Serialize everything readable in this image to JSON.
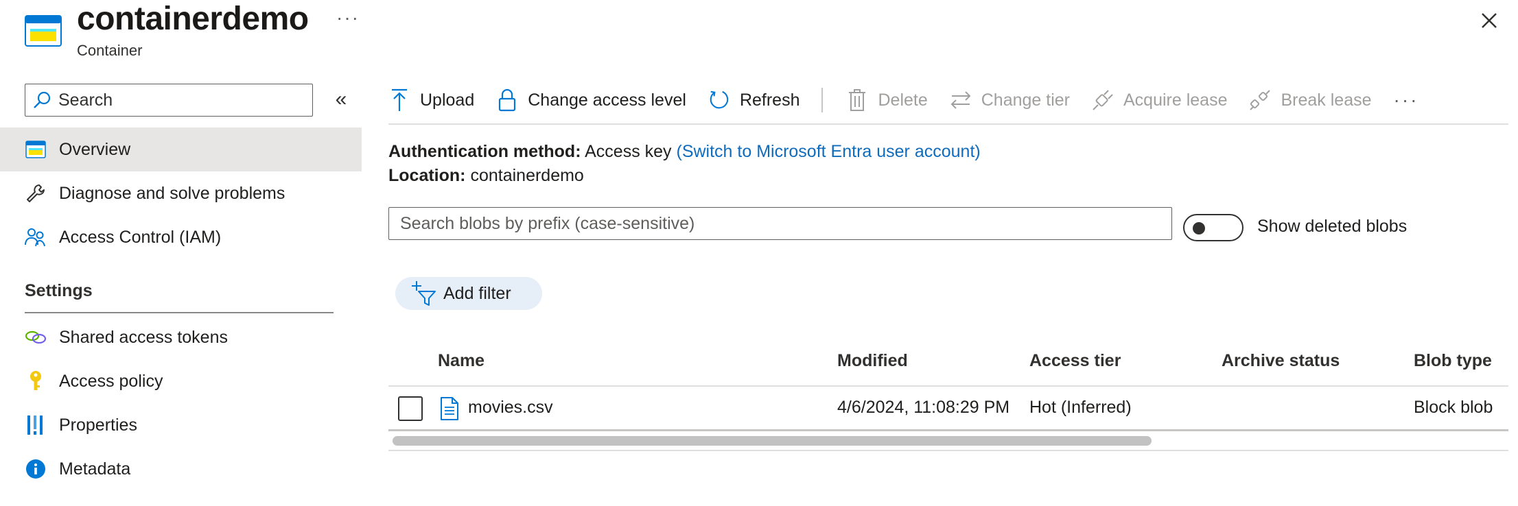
{
  "header": {
    "title": "containerdemo",
    "subtitle": "Container",
    "more_label": "···"
  },
  "sidebar": {
    "search_placeholder": "Search",
    "collapse_label": "«",
    "items": [
      {
        "label": "Overview",
        "icon": "container-icon",
        "active": true
      },
      {
        "label": "Diagnose and solve problems",
        "icon": "wrench-icon"
      },
      {
        "label": "Access Control (IAM)",
        "icon": "people-icon"
      }
    ],
    "settings_label": "Settings",
    "settings_items": [
      {
        "label": "Shared access tokens",
        "icon": "link-icon"
      },
      {
        "label": "Access policy",
        "icon": "key-icon"
      },
      {
        "label": "Properties",
        "icon": "properties-bars-icon"
      },
      {
        "label": "Metadata",
        "icon": "info-icon"
      }
    ]
  },
  "toolbar": {
    "upload": "Upload",
    "change_access_level": "Change access level",
    "refresh": "Refresh",
    "delete": "Delete",
    "change_tier": "Change tier",
    "acquire_lease": "Acquire lease",
    "break_lease": "Break lease",
    "more": "···"
  },
  "info": {
    "auth_label": "Authentication method:",
    "auth_value": "Access key",
    "auth_link": "(Switch to Microsoft Entra user account)",
    "location_label": "Location:",
    "location_value": "containerdemo"
  },
  "blob_search": {
    "placeholder": "Search blobs by prefix (case-sensitive)"
  },
  "toggle": {
    "label": "Show deleted blobs",
    "on": false
  },
  "filter": {
    "label": "Add filter"
  },
  "table": {
    "columns": [
      "Name",
      "Modified",
      "Access tier",
      "Archive status",
      "Blob type"
    ],
    "rows": [
      {
        "name": "movies.csv",
        "modified": "4/6/2024, 11:08:29 PM",
        "access_tier": "Hot (Inferred)",
        "archive_status": "",
        "blob_type": "Block blob"
      }
    ]
  },
  "colors": {
    "accent": "#0f6cbd",
    "active_nav_bg": "#e8e6e4",
    "filter_pill_bg": "#e6eef8"
  }
}
